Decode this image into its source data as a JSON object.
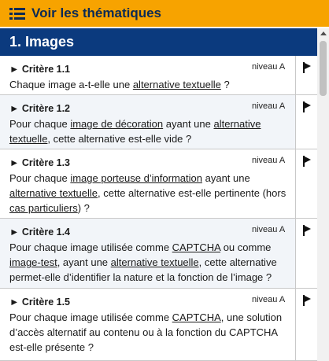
{
  "topbar": {
    "label": "Voir les thématiques",
    "icon": "list-icon"
  },
  "section": {
    "title": "1. Images"
  },
  "criteria": [
    {
      "title": "► Critère 1.1",
      "level": "niveau A",
      "parts": [
        "Chaque image a-t-elle une ",
        {
          "link": "alternative textuelle"
        },
        " ?"
      ]
    },
    {
      "title": "► Critère 1.2",
      "level": "niveau A",
      "parts": [
        "Pour chaque ",
        {
          "link": "image de décoration"
        },
        " ayant une ",
        {
          "link": "alternative textuelle"
        },
        ", cette alternative est-elle vide ?"
      ]
    },
    {
      "title": "► Critère 1.3",
      "level": "niveau A",
      "parts": [
        "Pour chaque ",
        {
          "link": "image porteuse d’information"
        },
        " ayant une ",
        {
          "link": "alternative textuelle"
        },
        ", cette alternative est-elle pertinente (hors ",
        {
          "link": "cas particuliers"
        },
        ") ?"
      ]
    },
    {
      "title": "► Critère 1.4",
      "level": "niveau A",
      "parts": [
        "Pour chaque image utilisée comme ",
        {
          "link": "CAPTCHA"
        },
        " ou comme ",
        {
          "link": "image-test"
        },
        ", ayant une ",
        {
          "link": "alternative textuelle"
        },
        ", cette alternative permet-elle d’identifier la nature et la fonction de l’image ?"
      ]
    },
    {
      "title": "► Critère 1.5",
      "level": "niveau A",
      "parts": [
        "Pour chaque image utilisée comme ",
        {
          "link": "CAPTCHA"
        },
        ", une solution d’accès alternatif au contenu ou à la fonction du CAPTCHA est-elle présente ?"
      ]
    }
  ]
}
